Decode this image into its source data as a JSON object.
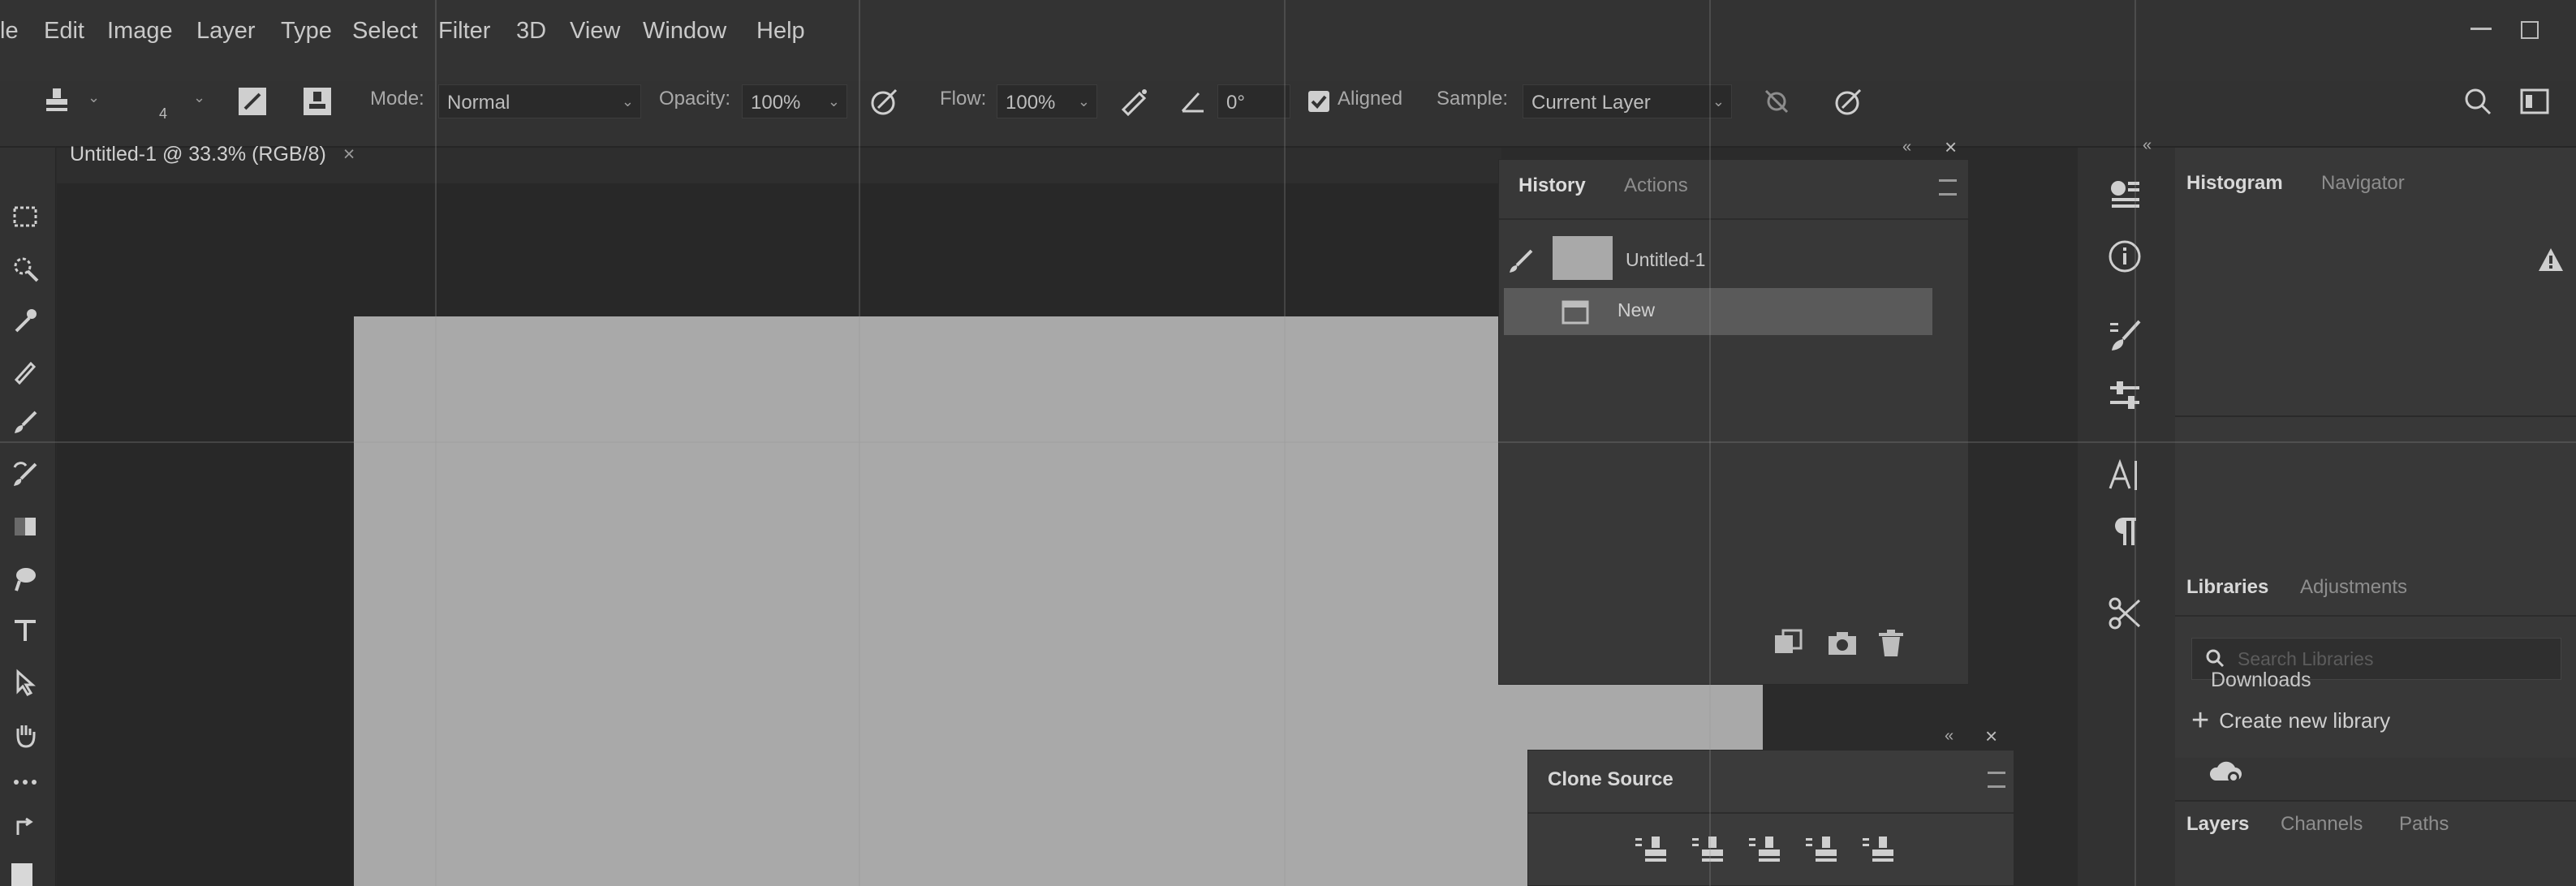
{
  "menu": {
    "items": [
      "le",
      "Edit",
      "Image",
      "Layer",
      "Type",
      "Select",
      "Filter",
      "3D",
      "View",
      "Window",
      "Help"
    ]
  },
  "options": {
    "brush_size": "4",
    "mode_label": "Mode:",
    "mode_value": "Normal",
    "opacity_label": "Opacity:",
    "opacity_value": "100%",
    "flow_label": "Flow:",
    "flow_value": "100%",
    "angle_value": "0°",
    "aligned_label": "Aligned",
    "sample_label": "Sample:",
    "sample_value": "Current Layer"
  },
  "document": {
    "tab_title": "Untitled-1 @ 33.3% (RGB/8)",
    "close_glyph": "×"
  },
  "history_panel": {
    "tabs": [
      "History",
      "Actions"
    ],
    "snapshot_name": "Untitled-1",
    "states": [
      "New"
    ]
  },
  "clone_source_panel": {
    "title": "Clone Source"
  },
  "right_panels": {
    "histogram_tabs": [
      "Histogram",
      "Navigator"
    ],
    "libraries_tabs": [
      "Libraries",
      "Adjustments"
    ],
    "search_placeholder": "Search Libraries",
    "create_library": "Create new library",
    "downloads": "Downloads",
    "layers_tabs": [
      "Layers",
      "Channels",
      "Paths"
    ]
  },
  "colors": {
    "background": "#2b2b2b",
    "panel": "#3a3a3a",
    "canvas": "#a9a9a9",
    "selected_row": "#5a5a5a"
  }
}
